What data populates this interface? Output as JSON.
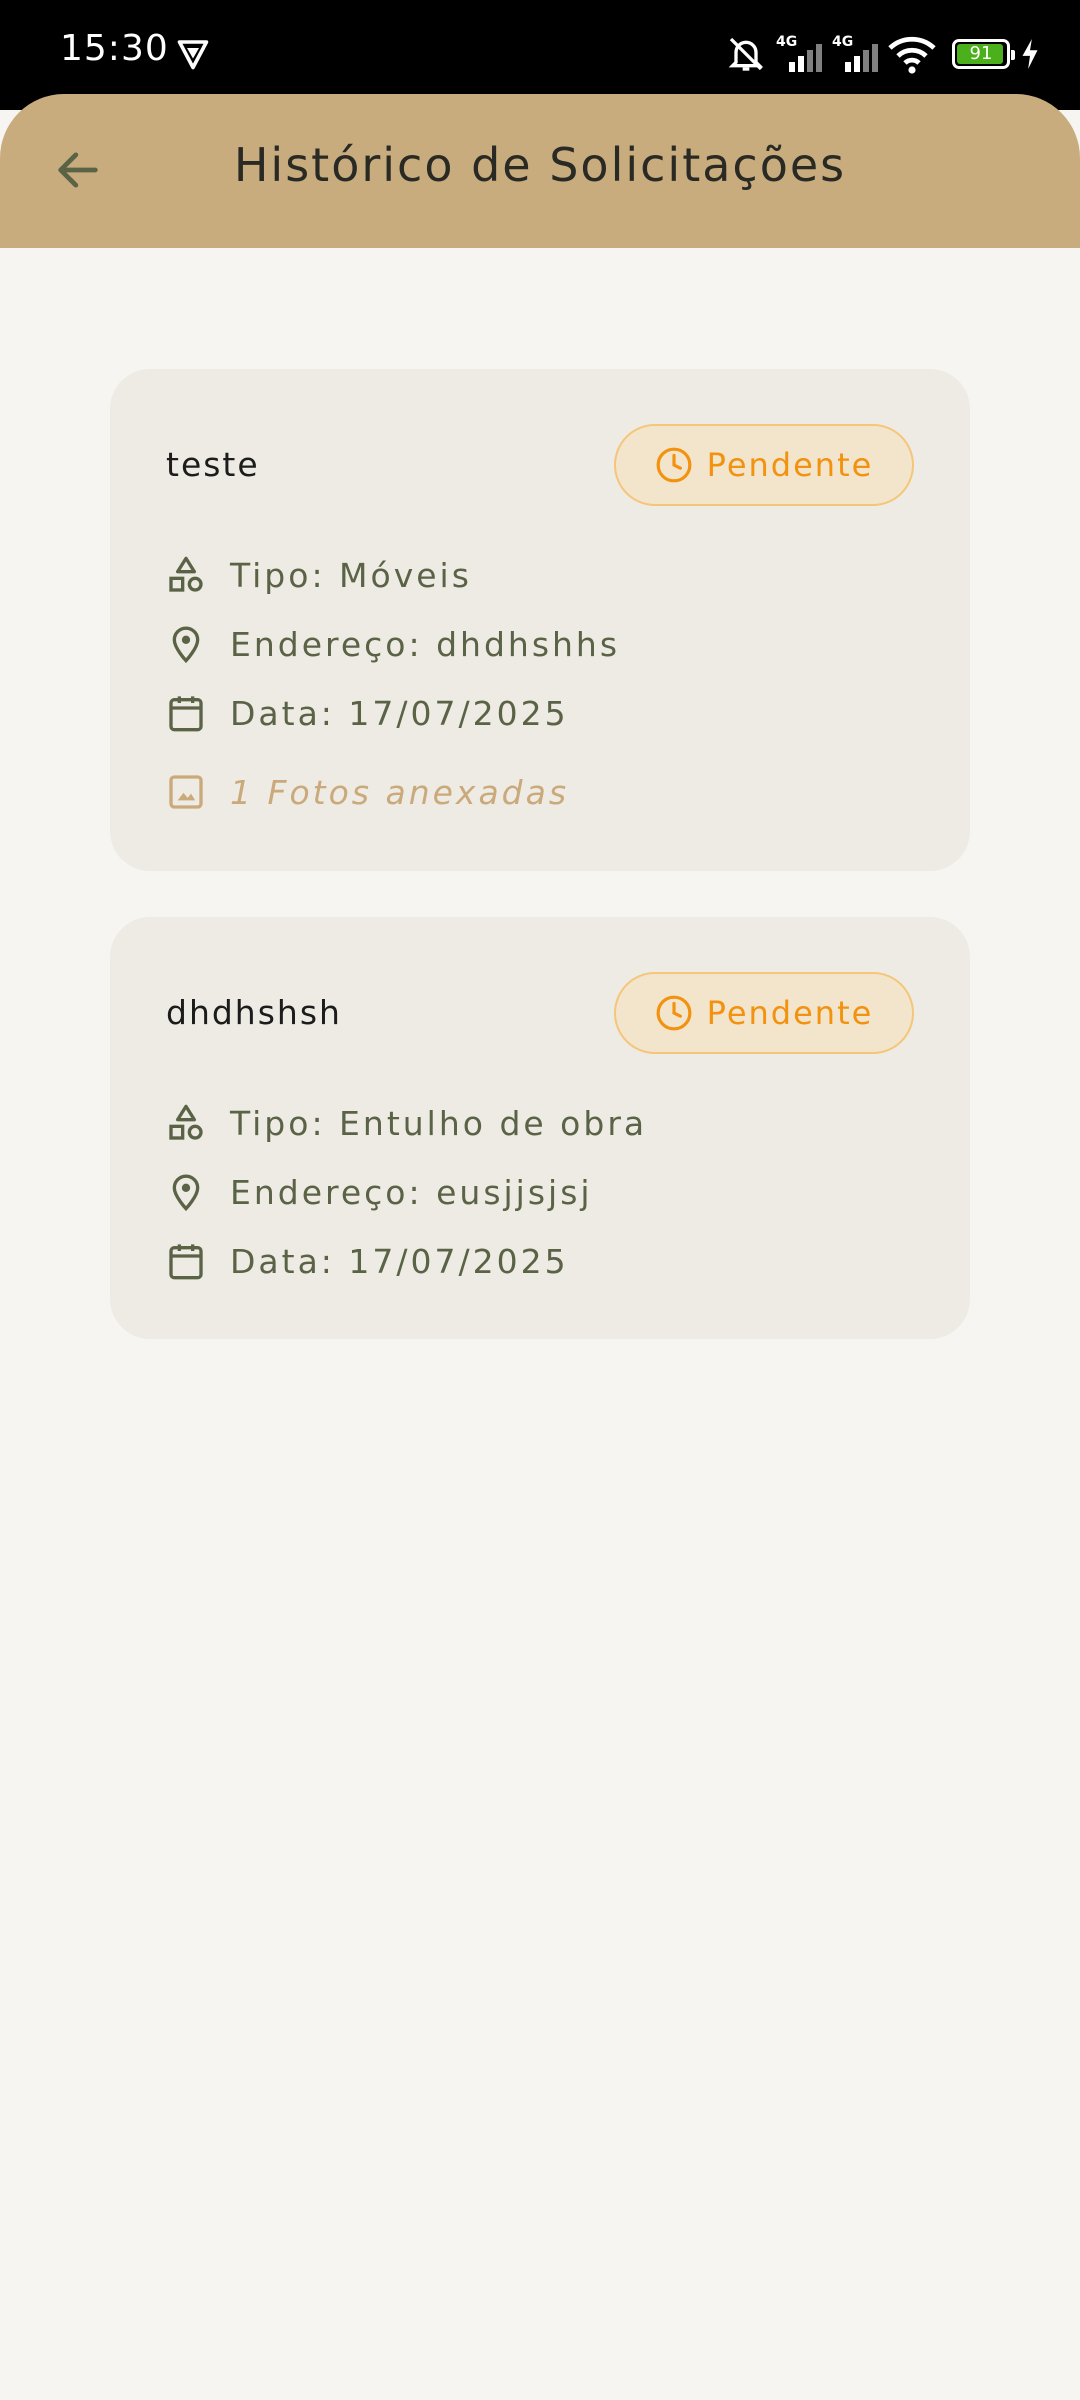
{
  "status_bar": {
    "time": "15:30",
    "network_1": "4G",
    "network_2": "4G",
    "battery": "91"
  },
  "header": {
    "title": "Histórico de Solicitações",
    "back_icon": "arrow-left-icon"
  },
  "requests": [
    {
      "title": "teste",
      "status": "Pendente",
      "tipo": "Tipo: Móveis",
      "endereco": "Endereço: dhdhshhs",
      "data": "Data: 17/07/2025",
      "fotos": "1 Fotos anexadas"
    },
    {
      "title": "dhdhshsh",
      "status": "Pendente",
      "tipo": "Tipo: Entulho de obra",
      "endereco": "Endereço: eusjjsjsj",
      "data": "Data: 17/07/2025"
    }
  ],
  "colors": {
    "header_bg": "#c8ac7d",
    "card_bg": "#edebe3",
    "status_text": "#f2920f",
    "status_bg": "#f3e4cc",
    "detail_text": "#5b6346"
  }
}
